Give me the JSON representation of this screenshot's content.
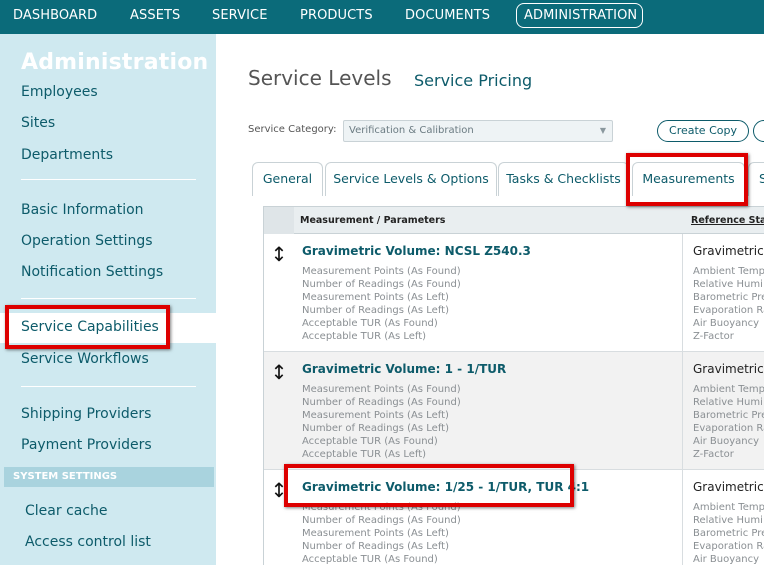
{
  "topnav": {
    "items": [
      "DASHBOARD",
      "ASSETS",
      "SERVICE",
      "PRODUCTS",
      "DOCUMENTS",
      "ADMINISTRATION"
    ],
    "active_index": 5
  },
  "sidebar": {
    "title": "Administration",
    "group1": [
      "Employees",
      "Sites",
      "Departments"
    ],
    "group2": [
      "Basic Information",
      "Operation Settings",
      "Notification Settings"
    ],
    "group3": [
      "Service Capabilities",
      "Service Workflows"
    ],
    "group4": [
      "Shipping Providers",
      "Payment Providers"
    ],
    "section_heading": "SYSTEM SETTINGS",
    "group5": [
      "Clear cache",
      "Access control list"
    ],
    "active_item": "Service Capabilities"
  },
  "main": {
    "title": "Service Levels",
    "link": "Service Pricing",
    "category_label": "Service Category:",
    "category_value": "Verification & Calibration",
    "create_copy_label": "Create Copy",
    "tabs": [
      "General",
      "Service Levels & Options",
      "Tasks & Checklists",
      "Measurements",
      "S"
    ],
    "active_tab": "Measurements",
    "table": {
      "col1_header": "Measurement / Parameters",
      "col2_header": "Reference Stan",
      "rows": [
        {
          "name": "Gravimetric Volume: NCSL Z540.3",
          "params": [
            "Measurement Points (As Found)",
            "Number of Readings (As Found)",
            "Measurement Points (As Left)",
            "Number of Readings (As Left)",
            "Acceptable TUR (As Found)",
            "Acceptable TUR (As Left)"
          ],
          "ref_name": "Gravimetric",
          "ref_params": [
            "Ambient Temp",
            "Relative Humi",
            "Barometric Pre",
            "Evaporation Ra",
            "Air Buoyancy",
            "Z-Factor"
          ]
        },
        {
          "name": "Gravimetric Volume: 1 - 1/TUR",
          "params": [
            "Measurement Points (As Found)",
            "Number of Readings (As Found)",
            "Measurement Points (As Left)",
            "Number of Readings (As Left)",
            "Acceptable TUR (As Found)",
            "Acceptable TUR (As Left)"
          ],
          "ref_name": "Gravimetric",
          "ref_params": [
            "Ambient Temp",
            "Relative Humi",
            "Barometric Pre",
            "Evaporation Ra",
            "Air Buoyancy",
            "Z-Factor"
          ]
        },
        {
          "name": "Gravimetric Volume: 1/25 - 1/TUR, TUR 4:1",
          "params": [
            "Measurement Points (As Found)",
            "Number of Readings (As Found)",
            "Measurement Points (As Left)",
            "Number of Readings (As Left)",
            "Acceptable TUR (As Found)"
          ],
          "ref_name": "Gravimetric",
          "ref_params": [
            "Ambient Temp",
            "Relative Humi",
            "Barometric Pre",
            "Evaporation Ra",
            "Air Buoyancy"
          ]
        }
      ]
    }
  },
  "colors": {
    "topnav_bg": "#0b6b7a",
    "sidebar_bg": "#cfe9f0",
    "link": "#0d5b6a",
    "highlight": "#dd0000"
  }
}
